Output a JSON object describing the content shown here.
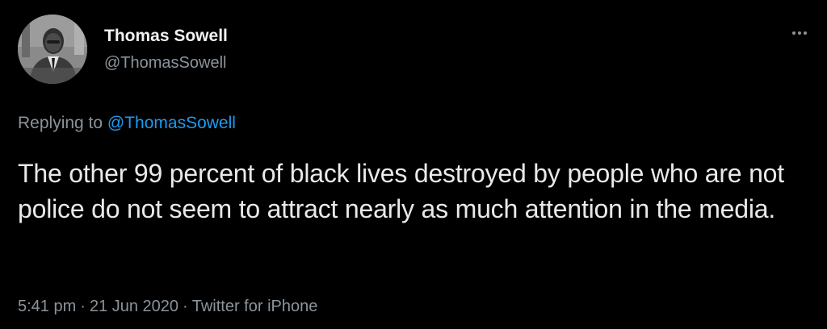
{
  "tweet": {
    "author": {
      "display_name": "Thomas Sowell",
      "handle": "@ThomasSowell",
      "avatar_icon": "profile-photo"
    },
    "more_icon": "more-horizontal-icon",
    "reply": {
      "prefix": "Replying to",
      "mention": "@ThomasSowell"
    },
    "text": "The other 99 percent of black lives destroyed by people who are not police do not seem to attract nearly as much attention in the media.",
    "meta": {
      "time": "5:41 pm",
      "separator": "·",
      "date": "21 Jun 2020",
      "source": "Twitter for iPhone"
    }
  },
  "colors": {
    "background": "#000000",
    "text_primary": "#e7e9ea",
    "text_secondary": "#8b939b",
    "link": "#1d9bf0"
  }
}
